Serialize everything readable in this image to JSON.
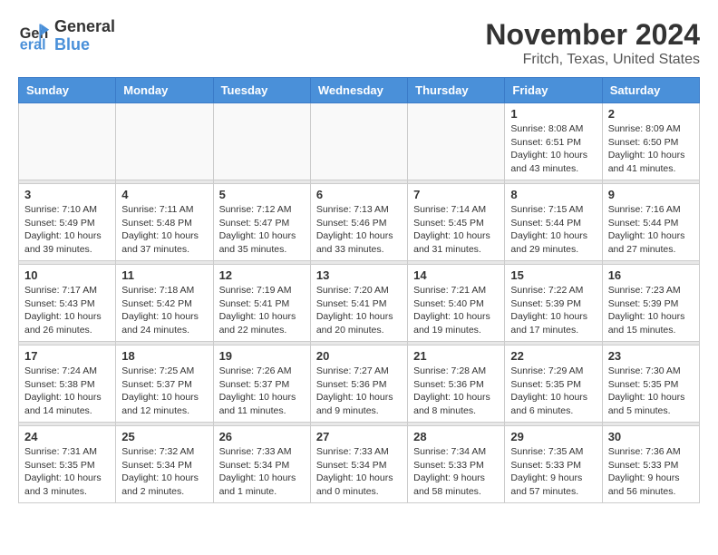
{
  "logo": {
    "text_general": "General",
    "text_blue": "Blue"
  },
  "title": "November 2024",
  "subtitle": "Fritch, Texas, United States",
  "days_of_week": [
    "Sunday",
    "Monday",
    "Tuesday",
    "Wednesday",
    "Thursday",
    "Friday",
    "Saturday"
  ],
  "weeks": [
    [
      {
        "day": "",
        "info": ""
      },
      {
        "day": "",
        "info": ""
      },
      {
        "day": "",
        "info": ""
      },
      {
        "day": "",
        "info": ""
      },
      {
        "day": "",
        "info": ""
      },
      {
        "day": "1",
        "info": "Sunrise: 8:08 AM\nSunset: 6:51 PM\nDaylight: 10 hours\nand 43 minutes."
      },
      {
        "day": "2",
        "info": "Sunrise: 8:09 AM\nSunset: 6:50 PM\nDaylight: 10 hours\nand 41 minutes."
      }
    ],
    [
      {
        "day": "3",
        "info": "Sunrise: 7:10 AM\nSunset: 5:49 PM\nDaylight: 10 hours\nand 39 minutes."
      },
      {
        "day": "4",
        "info": "Sunrise: 7:11 AM\nSunset: 5:48 PM\nDaylight: 10 hours\nand 37 minutes."
      },
      {
        "day": "5",
        "info": "Sunrise: 7:12 AM\nSunset: 5:47 PM\nDaylight: 10 hours\nand 35 minutes."
      },
      {
        "day": "6",
        "info": "Sunrise: 7:13 AM\nSunset: 5:46 PM\nDaylight: 10 hours\nand 33 minutes."
      },
      {
        "day": "7",
        "info": "Sunrise: 7:14 AM\nSunset: 5:45 PM\nDaylight: 10 hours\nand 31 minutes."
      },
      {
        "day": "8",
        "info": "Sunrise: 7:15 AM\nSunset: 5:44 PM\nDaylight: 10 hours\nand 29 minutes."
      },
      {
        "day": "9",
        "info": "Sunrise: 7:16 AM\nSunset: 5:44 PM\nDaylight: 10 hours\nand 27 minutes."
      }
    ],
    [
      {
        "day": "10",
        "info": "Sunrise: 7:17 AM\nSunset: 5:43 PM\nDaylight: 10 hours\nand 26 minutes."
      },
      {
        "day": "11",
        "info": "Sunrise: 7:18 AM\nSunset: 5:42 PM\nDaylight: 10 hours\nand 24 minutes."
      },
      {
        "day": "12",
        "info": "Sunrise: 7:19 AM\nSunset: 5:41 PM\nDaylight: 10 hours\nand 22 minutes."
      },
      {
        "day": "13",
        "info": "Sunrise: 7:20 AM\nSunset: 5:41 PM\nDaylight: 10 hours\nand 20 minutes."
      },
      {
        "day": "14",
        "info": "Sunrise: 7:21 AM\nSunset: 5:40 PM\nDaylight: 10 hours\nand 19 minutes."
      },
      {
        "day": "15",
        "info": "Sunrise: 7:22 AM\nSunset: 5:39 PM\nDaylight: 10 hours\nand 17 minutes."
      },
      {
        "day": "16",
        "info": "Sunrise: 7:23 AM\nSunset: 5:39 PM\nDaylight: 10 hours\nand 15 minutes."
      }
    ],
    [
      {
        "day": "17",
        "info": "Sunrise: 7:24 AM\nSunset: 5:38 PM\nDaylight: 10 hours\nand 14 minutes."
      },
      {
        "day": "18",
        "info": "Sunrise: 7:25 AM\nSunset: 5:37 PM\nDaylight: 10 hours\nand 12 minutes."
      },
      {
        "day": "19",
        "info": "Sunrise: 7:26 AM\nSunset: 5:37 PM\nDaylight: 10 hours\nand 11 minutes."
      },
      {
        "day": "20",
        "info": "Sunrise: 7:27 AM\nSunset: 5:36 PM\nDaylight: 10 hours\nand 9 minutes."
      },
      {
        "day": "21",
        "info": "Sunrise: 7:28 AM\nSunset: 5:36 PM\nDaylight: 10 hours\nand 8 minutes."
      },
      {
        "day": "22",
        "info": "Sunrise: 7:29 AM\nSunset: 5:35 PM\nDaylight: 10 hours\nand 6 minutes."
      },
      {
        "day": "23",
        "info": "Sunrise: 7:30 AM\nSunset: 5:35 PM\nDaylight: 10 hours\nand 5 minutes."
      }
    ],
    [
      {
        "day": "24",
        "info": "Sunrise: 7:31 AM\nSunset: 5:35 PM\nDaylight: 10 hours\nand 3 minutes."
      },
      {
        "day": "25",
        "info": "Sunrise: 7:32 AM\nSunset: 5:34 PM\nDaylight: 10 hours\nand 2 minutes."
      },
      {
        "day": "26",
        "info": "Sunrise: 7:33 AM\nSunset: 5:34 PM\nDaylight: 10 hours\nand 1 minute."
      },
      {
        "day": "27",
        "info": "Sunrise: 7:33 AM\nSunset: 5:34 PM\nDaylight: 10 hours\nand 0 minutes."
      },
      {
        "day": "28",
        "info": "Sunrise: 7:34 AM\nSunset: 5:33 PM\nDaylight: 9 hours\nand 58 minutes."
      },
      {
        "day": "29",
        "info": "Sunrise: 7:35 AM\nSunset: 5:33 PM\nDaylight: 9 hours\nand 57 minutes."
      },
      {
        "day": "30",
        "info": "Sunrise: 7:36 AM\nSunset: 5:33 PM\nDaylight: 9 hours\nand 56 minutes."
      }
    ]
  ]
}
